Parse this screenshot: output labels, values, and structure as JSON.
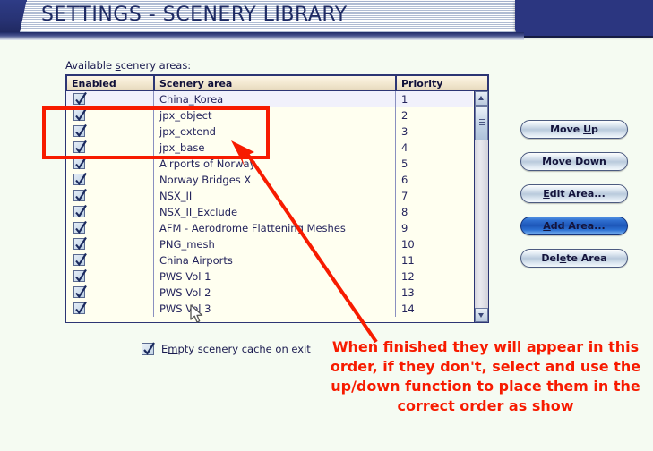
{
  "header": {
    "title": "SETTINGS - SCENERY LIBRARY"
  },
  "list": {
    "label_pre": "Available ",
    "label_accel": "s",
    "label_post": "cenery areas:",
    "columns": [
      "Enabled",
      "Scenery area",
      "Priority"
    ],
    "rows": [
      {
        "enabled": true,
        "name": "China_Korea",
        "priority": "1",
        "selected": true
      },
      {
        "enabled": true,
        "name": "jpx_object",
        "priority": "2",
        "selected": false
      },
      {
        "enabled": true,
        "name": "jpx_extend",
        "priority": "3",
        "selected": false
      },
      {
        "enabled": true,
        "name": "jpx_base",
        "priority": "4",
        "selected": false
      },
      {
        "enabled": true,
        "name": "Airports of Norway",
        "priority": "5",
        "selected": false
      },
      {
        "enabled": true,
        "name": "Norway Bridges X",
        "priority": "6",
        "selected": false
      },
      {
        "enabled": true,
        "name": "NSX_II",
        "priority": "7",
        "selected": false
      },
      {
        "enabled": true,
        "name": "NSX_II_Exclude",
        "priority": "8",
        "selected": false
      },
      {
        "enabled": true,
        "name": "AFM - Aerodrome Flattening Meshes",
        "priority": "9",
        "selected": false
      },
      {
        "enabled": true,
        "name": "PNG_mesh",
        "priority": "10",
        "selected": false
      },
      {
        "enabled": true,
        "name": "China Airports",
        "priority": "11",
        "selected": false
      },
      {
        "enabled": true,
        "name": "PWS Vol 1",
        "priority": "12",
        "selected": false
      },
      {
        "enabled": true,
        "name": "PWS Vol 2",
        "priority": "13",
        "selected": false
      },
      {
        "enabled": true,
        "name": "PWS Vol 3",
        "priority": "14",
        "selected": false
      }
    ]
  },
  "scrollbar": {
    "up_icon": "triangle-up-icon",
    "down_icon": "triangle-down-icon"
  },
  "buttons": [
    {
      "pre": "Move ",
      "accel": "U",
      "post": "p",
      "focused": false
    },
    {
      "pre": "Move ",
      "accel": "D",
      "post": "own",
      "focused": false
    },
    {
      "pre": "",
      "accel": "E",
      "post": "dit Area...",
      "focused": false
    },
    {
      "pre": "",
      "accel": "A",
      "post": "dd Area...",
      "focused": true
    },
    {
      "pre": "Del",
      "accel": "e",
      "post": "te Area",
      "focused": false
    }
  ],
  "bottom_option": {
    "checked": true,
    "pre": "E",
    "accel": "m",
    "post": "pty scenery cache on exit"
  },
  "annotation": {
    "color": "#f71b00",
    "lines": [
      "When finished they will appear in this",
      "order, if they don't, select and use the",
      "up/down function to place them in the",
      "correct order as show"
    ]
  }
}
